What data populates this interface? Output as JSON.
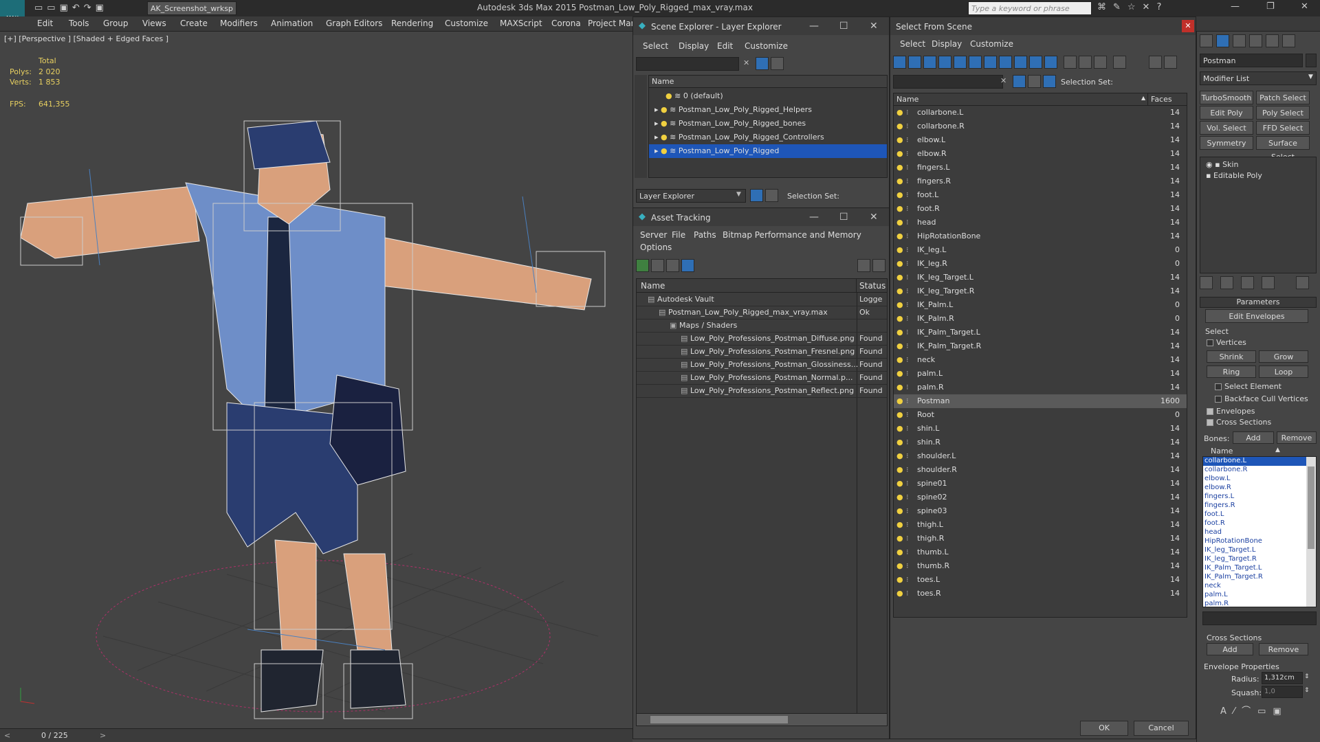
{
  "app": {
    "logo": "MAX",
    "workspace": "AK_Screenshot_wrksp",
    "title": "Autodesk 3ds Max  2015    Postman_Low_Poly_Rigged_max_vray.max",
    "search_placeholder": "Type a keyword or phrase"
  },
  "menu": [
    "Edit",
    "Tools",
    "Group",
    "Views",
    "Create",
    "Modifiers",
    "Animation",
    "Graph Editors",
    "Rendering",
    "Customize",
    "MAXScript",
    "Corona",
    "Project Man"
  ],
  "viewport": {
    "label": "[+] [Perspective ] [Shaded + Edged Faces ]",
    "stats_total": "Total",
    "polys_label": "Polys:",
    "polys_value": "2 020",
    "verts_label": "Verts:",
    "verts_value": "1 853",
    "fps_label": "FPS:",
    "fps_value": "641,355"
  },
  "status": {
    "frame": "0 / 225"
  },
  "scene_explorer": {
    "title": "Scene Explorer - Layer Explorer",
    "menu": [
      "Select",
      "Display",
      "Edit",
      "Customize"
    ],
    "col_name": "Name",
    "layers": [
      {
        "name": "0 (default)",
        "selected": false
      },
      {
        "name": "Postman_Low_Poly_Rigged_Helpers",
        "selected": false
      },
      {
        "name": "Postman_Low_Poly_Rigged_bones",
        "selected": false
      },
      {
        "name": "Postman_Low_Poly_Rigged_Controllers",
        "selected": false
      },
      {
        "name": "Postman_Low_Poly_Rigged",
        "selected": true
      }
    ],
    "footer_dropdown": "Layer Explorer",
    "selection_set": "Selection Set:"
  },
  "asset_tracking": {
    "title": "Asset Tracking",
    "menu": [
      "Server",
      "File",
      "Paths",
      "Bitmap Performance and Memory"
    ],
    "menu2": "Options",
    "col_name": "Name",
    "col_status": "Status",
    "rows": [
      {
        "name": "Autodesk Vault",
        "status": "Logge",
        "indent": 1
      },
      {
        "name": "Postman_Low_Poly_Rigged_max_vray.max",
        "status": "Ok",
        "indent": 2
      },
      {
        "name": "Maps / Shaders",
        "status": "",
        "indent": 3
      },
      {
        "name": "Low_Poly_Professions_Postman_Diffuse.png",
        "status": "Found",
        "indent": 4
      },
      {
        "name": "Low_Poly_Professions_Postman_Fresnel.png",
        "status": "Found",
        "indent": 4
      },
      {
        "name": "Low_Poly_Professions_Postman_Glossiness...",
        "status": "Found",
        "indent": 4
      },
      {
        "name": "Low_Poly_Professions_Postman_Normal.p...",
        "status": "Found",
        "indent": 4
      },
      {
        "name": "Low_Poly_Professions_Postman_Reflect.png",
        "status": "Found",
        "indent": 4
      }
    ]
  },
  "select_from_scene": {
    "title": "Select From Scene",
    "menu": [
      "Select",
      "Display",
      "Customize"
    ],
    "selection_set": "Selection Set:",
    "col_name": "Name",
    "col_faces": "Faces",
    "rows": [
      {
        "name": "collarbone.L",
        "faces": "14"
      },
      {
        "name": "collarbone.R",
        "faces": "14"
      },
      {
        "name": "elbow.L",
        "faces": "14"
      },
      {
        "name": "elbow.R",
        "faces": "14"
      },
      {
        "name": "fingers.L",
        "faces": "14"
      },
      {
        "name": "fingers.R",
        "faces": "14"
      },
      {
        "name": "foot.L",
        "faces": "14"
      },
      {
        "name": "foot.R",
        "faces": "14"
      },
      {
        "name": "head",
        "faces": "14"
      },
      {
        "name": "HipRotationBone",
        "faces": "14"
      },
      {
        "name": "IK_leg.L",
        "faces": "0"
      },
      {
        "name": "IK_leg.R",
        "faces": "0"
      },
      {
        "name": "IK_leg_Target.L",
        "faces": "14"
      },
      {
        "name": "IK_leg_Target.R",
        "faces": "14"
      },
      {
        "name": "IK_Palm.L",
        "faces": "0"
      },
      {
        "name": "IK_Palm.R",
        "faces": "0"
      },
      {
        "name": "IK_Palm_Target.L",
        "faces": "14"
      },
      {
        "name": "IK_Palm_Target.R",
        "faces": "14"
      },
      {
        "name": "neck",
        "faces": "14"
      },
      {
        "name": "palm.L",
        "faces": "14"
      },
      {
        "name": "palm.R",
        "faces": "14"
      },
      {
        "name": "Postman",
        "faces": "1600",
        "selected": true
      },
      {
        "name": "Root",
        "faces": "0"
      },
      {
        "name": "shin.L",
        "faces": "14"
      },
      {
        "name": "shin.R",
        "faces": "14"
      },
      {
        "name": "shoulder.L",
        "faces": "14"
      },
      {
        "name": "shoulder.R",
        "faces": "14"
      },
      {
        "name": "spine01",
        "faces": "14"
      },
      {
        "name": "spine02",
        "faces": "14"
      },
      {
        "name": "spine03",
        "faces": "14"
      },
      {
        "name": "thigh.L",
        "faces": "14"
      },
      {
        "name": "thigh.R",
        "faces": "14"
      },
      {
        "name": "thumb.L",
        "faces": "14"
      },
      {
        "name": "thumb.R",
        "faces": "14"
      },
      {
        "name": "toes.L",
        "faces": "14"
      },
      {
        "name": "toes.R",
        "faces": "14"
      }
    ],
    "ok": "OK",
    "cancel": "Cancel"
  },
  "command_panel": {
    "object_name": "Postman",
    "modifier_list": "Modifier List",
    "mod_buttons": [
      "TurboSmooth",
      "Patch Select",
      "Edit Poly",
      "Poly Select",
      "Vol. Select",
      "FFD Select",
      "Symmetry",
      "Surface Select"
    ],
    "stack": [
      "Skin",
      "Editable Poly"
    ],
    "parameters": "Parameters",
    "edit_envelopes": "Edit Envelopes",
    "select_group": "Select",
    "vertices": "Vertices",
    "shrink": "Shrink",
    "grow": "Grow",
    "ring": "Ring",
    "loop": "Loop",
    "select_element": "Select Element",
    "backface_cull": "Backface Cull Vertices",
    "envelopes": "Envelopes",
    "cross_sections": "Cross Sections",
    "bones_label": "Bones:",
    "add": "Add",
    "remove": "Remove",
    "name_col": "Name",
    "bones": [
      "collarbone.L",
      "collarbone.R",
      "elbow.L",
      "elbow.R",
      "fingers.L",
      "fingers.R",
      "foot.L",
      "foot.R",
      "head",
      "HipRotationBone",
      "IK_leg_Target.L",
      "IK_leg_Target.R",
      "IK_Palm_Target.L",
      "IK_Palm_Target.R",
      "neck",
      "palm.L",
      "palm.R"
    ],
    "cross_sections_group": "Cross Sections",
    "cs_add": "Add",
    "cs_remove": "Remove",
    "envelope_props": "Envelope Properties",
    "radius_label": "Radius:",
    "radius_value": "1,312cm",
    "squash_label": "Squash:",
    "squash_value": "1,0"
  },
  "colors": {
    "accent": "#1e56b8",
    "bulb": "#f0d040",
    "panel": "#454545",
    "viewport": "#444444"
  }
}
